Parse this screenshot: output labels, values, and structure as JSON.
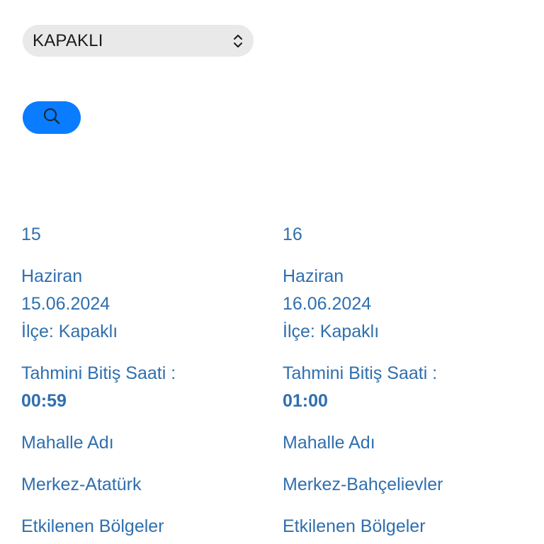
{
  "filter": {
    "selected_district": "KAPAKLI"
  },
  "search_button": {
    "icon": "search-icon"
  },
  "colors": {
    "accent": "#0a7cff",
    "text_link": "#2f6fae",
    "select_bg": "#e9e9ea"
  },
  "outages": [
    {
      "day": "15",
      "month": "Haziran",
      "date": "15.06.2024",
      "district": "İlçe: Kapaklı",
      "est_end_label": "Tahmini Bitiş Saati :",
      "est_end_time": "00:59",
      "neighborhood_label": "Mahalle Adı",
      "neighborhood": "Merkez-Atatürk",
      "affected_label": "Etkilenen Bölgeler"
    },
    {
      "day": "16",
      "month": "Haziran",
      "date": "16.06.2024",
      "district": "İlçe: Kapaklı",
      "est_end_label": "Tahmini Bitiş Saati :",
      "est_end_time": "01:00",
      "neighborhood_label": "Mahalle Adı",
      "neighborhood": "Merkez-Bahçelievler",
      "affected_label": "Etkilenen Bölgeler"
    }
  ]
}
